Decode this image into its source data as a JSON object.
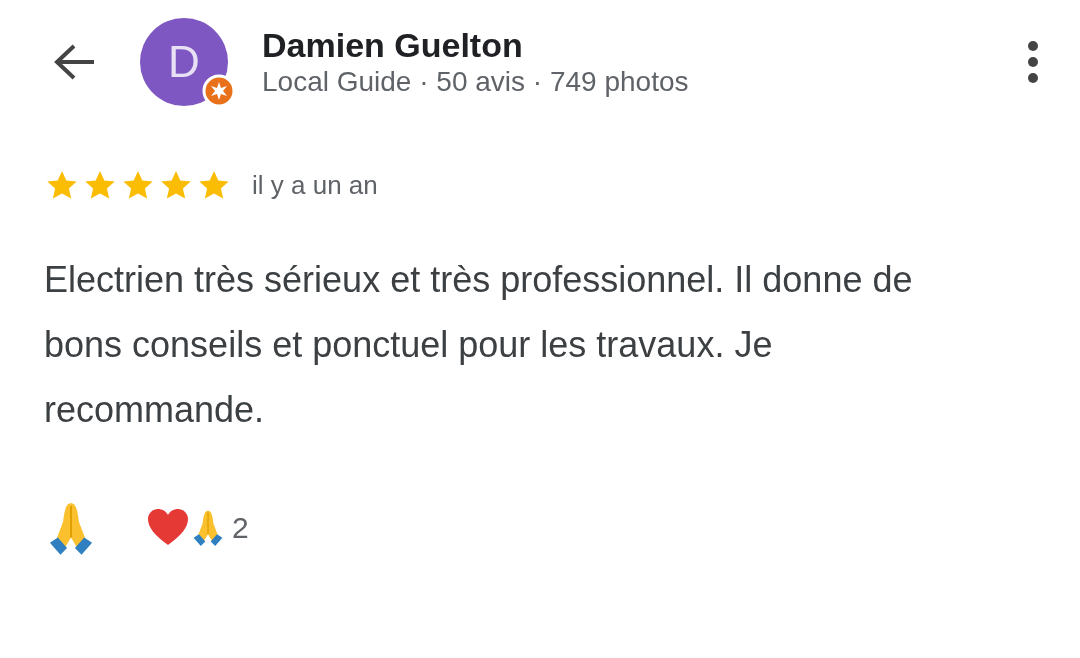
{
  "reviewer": {
    "avatar_letter": "D",
    "local_guide_badge": true,
    "name": "Damien Guelton",
    "subtitle": "Local Guide · 50 avis · 749 photos"
  },
  "review": {
    "stars": 5,
    "time": "il y a un an",
    "text": "Electrien très sérieux et très professionnel. Il donne de bons conseils et ponctuel pour les travaux. Je recommande."
  },
  "reactions": {
    "count": "2"
  }
}
